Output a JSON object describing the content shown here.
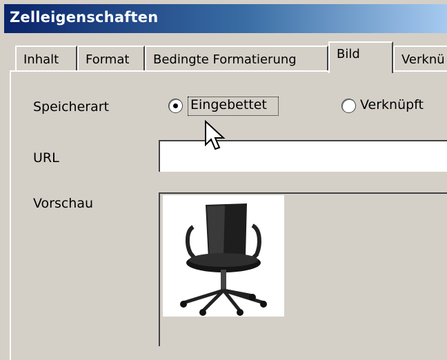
{
  "dialog": {
    "title": "Zelleigenschaften"
  },
  "tabs": [
    {
      "label": "Inhalt",
      "active": false
    },
    {
      "label": "Format",
      "active": false
    },
    {
      "label": "Bedingte Formatierung",
      "active": false
    },
    {
      "label": "Bild",
      "active": true
    },
    {
      "label": "Verknü",
      "active": false
    }
  ],
  "form": {
    "speicherart_label": "Speicherart",
    "options": [
      {
        "label": "Eingebettet",
        "selected": true
      },
      {
        "label": "Verknüpft",
        "selected": false
      }
    ],
    "url_label": "URL",
    "url_value": "",
    "vorschau_label": "Vorschau"
  },
  "preview": {
    "icon": "office-chair-image"
  }
}
